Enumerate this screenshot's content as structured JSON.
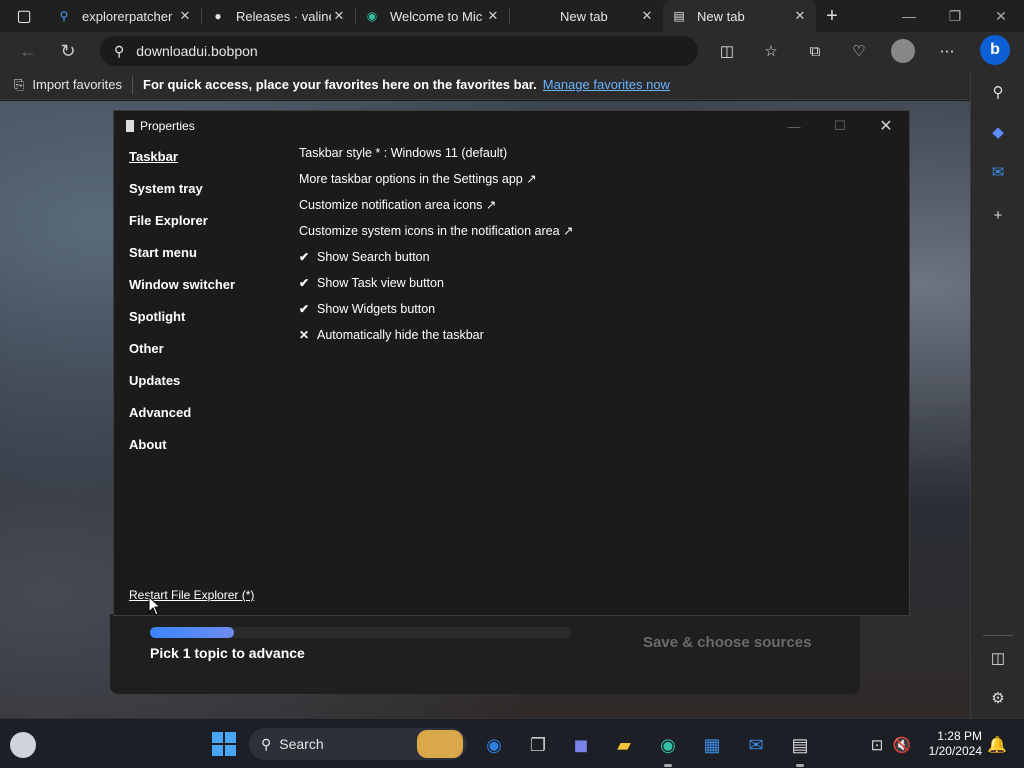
{
  "browser": {
    "tabs": [
      {
        "title": "explorerpatcher",
        "icon": "search-favicon"
      },
      {
        "title": "Releases · valine",
        "icon": "github-favicon"
      },
      {
        "title": "Welcome to Mic",
        "icon": "edge-favicon"
      },
      {
        "title": "New tab",
        "icon": "none"
      },
      {
        "title": "New tab",
        "icon": "newtab-favicon",
        "active": true
      }
    ],
    "address": "downloadui.bobpon",
    "favorites_bar": {
      "import_label": "Import favorites",
      "message": "For quick access, place your favorites here on the favorites bar.",
      "manage_link": "Manage favorites now"
    }
  },
  "page": {
    "pick_text": "Pick 1 topic to advance",
    "save_button": "Save & choose sources",
    "progress_fraction": 0.2
  },
  "properties": {
    "title": "Properties",
    "nav": [
      "Taskbar",
      "System tray",
      "File Explorer",
      "Start menu",
      "Window switcher",
      "Spotlight",
      "Other",
      "Updates",
      "Advanced",
      "About"
    ],
    "options": [
      {
        "mark": "",
        "text": "Taskbar style * : Windows 11 (default)"
      },
      {
        "mark": "",
        "text": "More taskbar options in the Settings app ↗"
      },
      {
        "mark": "",
        "text": "Customize notification area icons ↗"
      },
      {
        "mark": "",
        "text": "Customize system icons in the notification area ↗"
      },
      {
        "mark": "✔",
        "text": "Show Search button"
      },
      {
        "mark": "✔",
        "text": "Show Task view button"
      },
      {
        "mark": "✔",
        "text": "Show Widgets button"
      },
      {
        "mark": "✕",
        "text": "Automatically hide the taskbar"
      }
    ],
    "restart_link": "Restart File Explorer (*)"
  },
  "taskbar": {
    "search_label": "Search",
    "time": "1:28 PM",
    "date": "1/20/2024"
  },
  "colors": {
    "accent": "#3b84ff",
    "link": "#6cb4ff"
  }
}
